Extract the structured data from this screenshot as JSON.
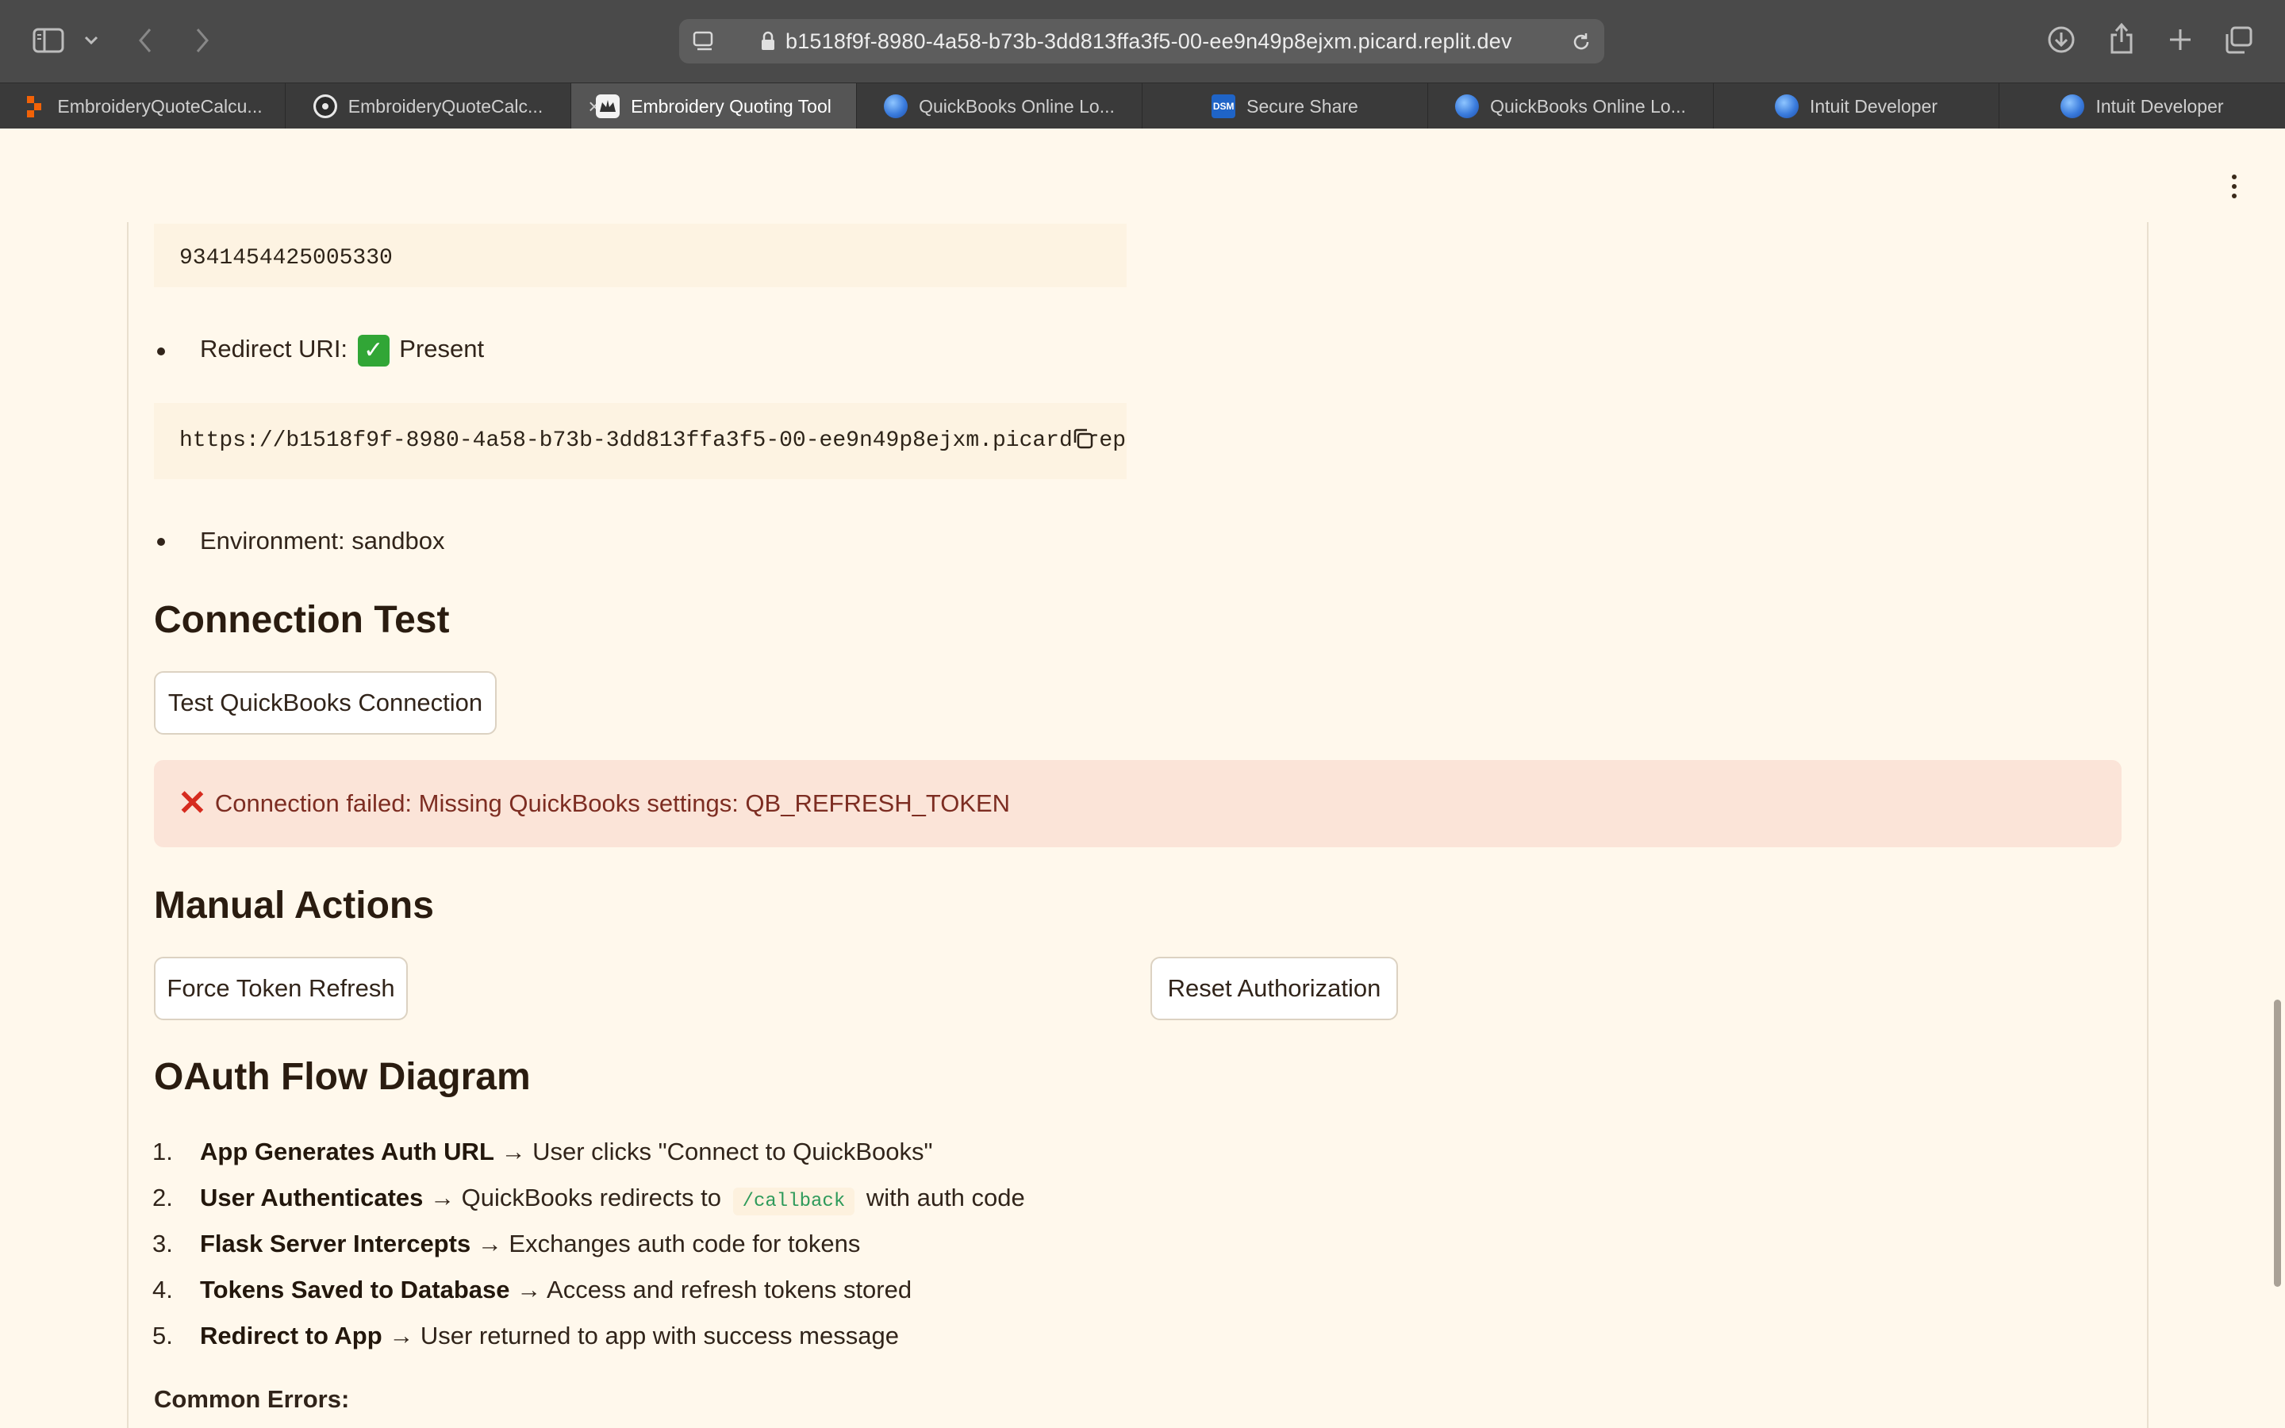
{
  "browser": {
    "url": "b1518f9f-8980-4a58-b73b-3dd813ffa3f5-00-ee9n49p8ejxm.picard.replit.dev",
    "tabs": [
      {
        "label": "EmbroideryQuoteCalcu...",
        "icon": "replit-icon",
        "active": false
      },
      {
        "label": "EmbroideryQuoteCalc...",
        "icon": "github-icon",
        "active": false
      },
      {
        "label": "Embroidery Quoting Tool",
        "icon": "streamlit-icon",
        "active": true
      },
      {
        "label": "QuickBooks Online Lo...",
        "icon": "globe-icon",
        "active": false
      },
      {
        "label": "Secure Share",
        "icon": "dsm-icon",
        "active": false
      },
      {
        "label": "QuickBooks Online Lo...",
        "icon": "globe-icon",
        "active": false
      },
      {
        "label": "Intuit Developer",
        "icon": "globe-icon",
        "active": false
      },
      {
        "label": "Intuit Developer",
        "icon": "globe-icon",
        "active": false
      }
    ]
  },
  "config": {
    "client_id_value": "9341454425005330",
    "redirect_label": "Redirect URI:",
    "redirect_status": "Present",
    "redirect_value": "https://b1518f9f-8980-4a58-b73b-3dd813ffa3f5-00-ee9n49p8ejxm.picard.rep",
    "environment_label": "Environment: sandbox"
  },
  "connection_test": {
    "heading": "Connection Test",
    "button": "Test QuickBooks Connection",
    "error": "Connection failed: Missing QuickBooks settings: QB_REFRESH_TOKEN"
  },
  "manual_actions": {
    "heading": "Manual Actions",
    "force_refresh": "Force Token Refresh",
    "reset": "Reset Authorization"
  },
  "oauth_flow": {
    "heading": "OAuth Flow Diagram",
    "steps": [
      {
        "num": "1.",
        "bold": "App Generates Auth URL",
        "text": " → User clicks \"Connect to QuickBooks\""
      },
      {
        "num": "2.",
        "bold": "User Authenticates",
        "text": " → QuickBooks redirects to",
        "code": "/callback",
        "after": "with auth code"
      },
      {
        "num": "3.",
        "bold": "Flask Server Intercepts",
        "text": " → Exchanges auth code for tokens"
      },
      {
        "num": "4.",
        "bold": "Tokens Saved to Database",
        "text": " → Access and refresh tokens stored"
      },
      {
        "num": "5.",
        "bold": "Redirect to App",
        "text": " → User returned to app with success message"
      }
    ]
  },
  "common_errors": {
    "heading": "Common Errors:"
  },
  "colors": {
    "page_bg": "#fff8ec",
    "error_bg": "#fbe4d8",
    "error_text": "#7d2d22",
    "code_green": "#2e9a5a"
  }
}
